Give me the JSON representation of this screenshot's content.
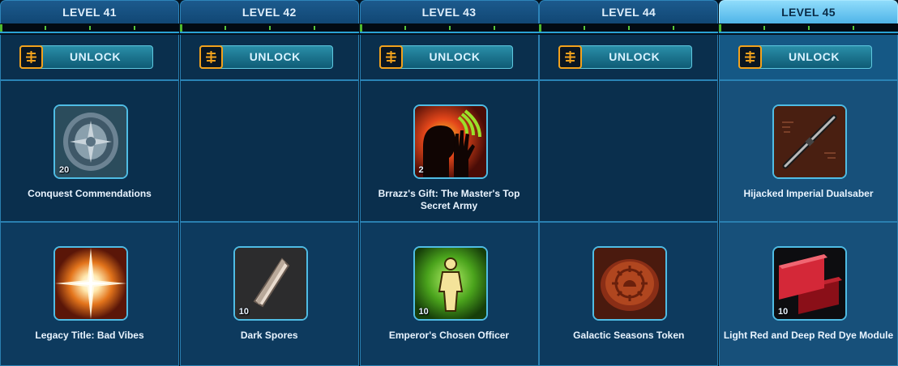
{
  "currency_icon": "battle-pass-currency-icon",
  "colors": {
    "header": "#1c5a8d",
    "current_header": "#8fdcfb",
    "coin_border": "#f2a11c",
    "tick": "#57c83a",
    "frame": "#4fbce4"
  },
  "levels": [
    {
      "label": "LEVEL 41",
      "unlock_label": "UNLOCK",
      "top_reward": {
        "name": "Conquest Commendations",
        "qty": "20",
        "icon": "conquest-medallion-icon"
      },
      "bottom_reward": {
        "name": "Legacy Title: Bad Vibes",
        "qty": "",
        "icon": "light-burst-icon"
      }
    },
    {
      "label": "LEVEL 42",
      "unlock_label": "UNLOCK",
      "top_reward": null,
      "bottom_reward": {
        "name": "Dark Spores",
        "qty": "10",
        "icon": "crystal-spore-icon"
      }
    },
    {
      "label": "LEVEL 43",
      "unlock_label": "UNLOCK",
      "top_reward": {
        "name": "Brrazz's Gift: The Master's Top Secret Army",
        "qty": "2",
        "icon": "silhouette-hand-icon"
      },
      "bottom_reward": {
        "name": "Emperor's Chosen Officer",
        "qty": "10",
        "icon": "officer-figure-icon"
      }
    },
    {
      "label": "LEVEL 44",
      "unlock_label": "UNLOCK",
      "top_reward": null,
      "bottom_reward": {
        "name": "Galactic Seasons Token",
        "qty": "",
        "icon": "seasons-token-icon"
      }
    },
    {
      "label": "LEVEL 45",
      "unlock_label": "UNLOCK",
      "current": true,
      "top_reward": {
        "name": "Hijacked Imperial Dualsaber",
        "qty": "",
        "icon": "dualsaber-icon"
      },
      "bottom_reward": {
        "name": "Light Red and Deep Red Dye Module",
        "qty": "10",
        "icon": "dye-module-icon"
      }
    }
  ]
}
